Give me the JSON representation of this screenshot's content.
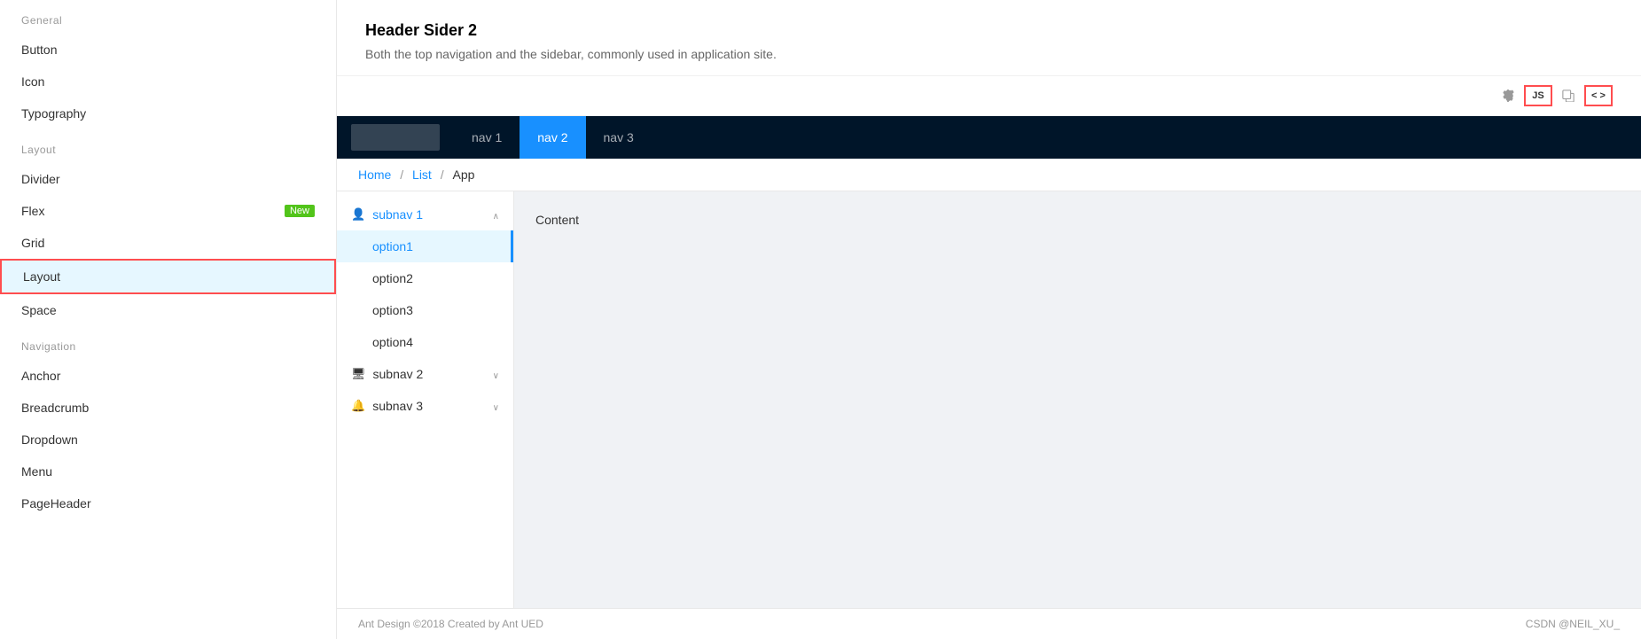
{
  "sidebar": {
    "sections": [
      {
        "label": "General",
        "items": [
          {
            "id": "button",
            "label": "Button",
            "badge": null,
            "active": false
          },
          {
            "id": "icon",
            "label": "Icon",
            "badge": null,
            "active": false
          },
          {
            "id": "typography",
            "label": "Typography",
            "badge": null,
            "active": false
          }
        ]
      },
      {
        "label": "Layout",
        "items": [
          {
            "id": "divider",
            "label": "Divider",
            "badge": null,
            "active": false
          },
          {
            "id": "flex",
            "label": "Flex",
            "badge": "New",
            "active": false
          },
          {
            "id": "grid",
            "label": "Grid",
            "badge": null,
            "active": false
          },
          {
            "id": "layout",
            "label": "Layout",
            "badge": null,
            "active": true
          },
          {
            "id": "space",
            "label": "Space",
            "badge": null,
            "active": false
          }
        ]
      },
      {
        "label": "Navigation",
        "items": [
          {
            "id": "anchor",
            "label": "Anchor",
            "badge": null,
            "active": false
          },
          {
            "id": "breadcrumb",
            "label": "Breadcrumb",
            "badge": null,
            "active": false
          },
          {
            "id": "dropdown",
            "label": "Dropdown",
            "badge": null,
            "active": false
          },
          {
            "id": "menu",
            "label": "Menu",
            "badge": null,
            "active": false
          },
          {
            "id": "pageheader",
            "label": "PageHeader",
            "badge": null,
            "active": false
          }
        ]
      }
    ]
  },
  "demo": {
    "title": "Header Sider 2",
    "description": "Both the top navigation and the sidebar, commonly used in application site.",
    "toolbar": {
      "js_label": "JS",
      "code_label": "< >"
    }
  },
  "preview": {
    "top_nav": {
      "nav_items": [
        {
          "id": "nav1",
          "label": "nav 1",
          "active": false
        },
        {
          "id": "nav2",
          "label": "nav 2",
          "active": true
        },
        {
          "id": "nav3",
          "label": "nav 3",
          "active": false
        }
      ]
    },
    "breadcrumb": {
      "items": [
        "Home",
        "List",
        "App"
      ],
      "separators": [
        "/",
        "/"
      ]
    },
    "side_menu": {
      "groups": [
        {
          "id": "subnav1",
          "label": "subnav 1",
          "icon": "user",
          "expanded": true,
          "children": [
            {
              "id": "option1",
              "label": "option1",
              "active": true
            },
            {
              "id": "option2",
              "label": "option2",
              "active": false
            },
            {
              "id": "option3",
              "label": "option3",
              "active": false
            },
            {
              "id": "option4",
              "label": "option4",
              "active": false
            }
          ]
        },
        {
          "id": "subnav2",
          "label": "subnav 2",
          "icon": "monitor",
          "expanded": false,
          "children": []
        },
        {
          "id": "subnav3",
          "label": "subnav 3",
          "icon": "notification",
          "expanded": false,
          "children": []
        }
      ]
    },
    "content": "Content"
  },
  "footer": {
    "copyright": "Ant Design ©2018 Created by Ant UED",
    "watermark": "CSDN @NEIL_XU_"
  }
}
